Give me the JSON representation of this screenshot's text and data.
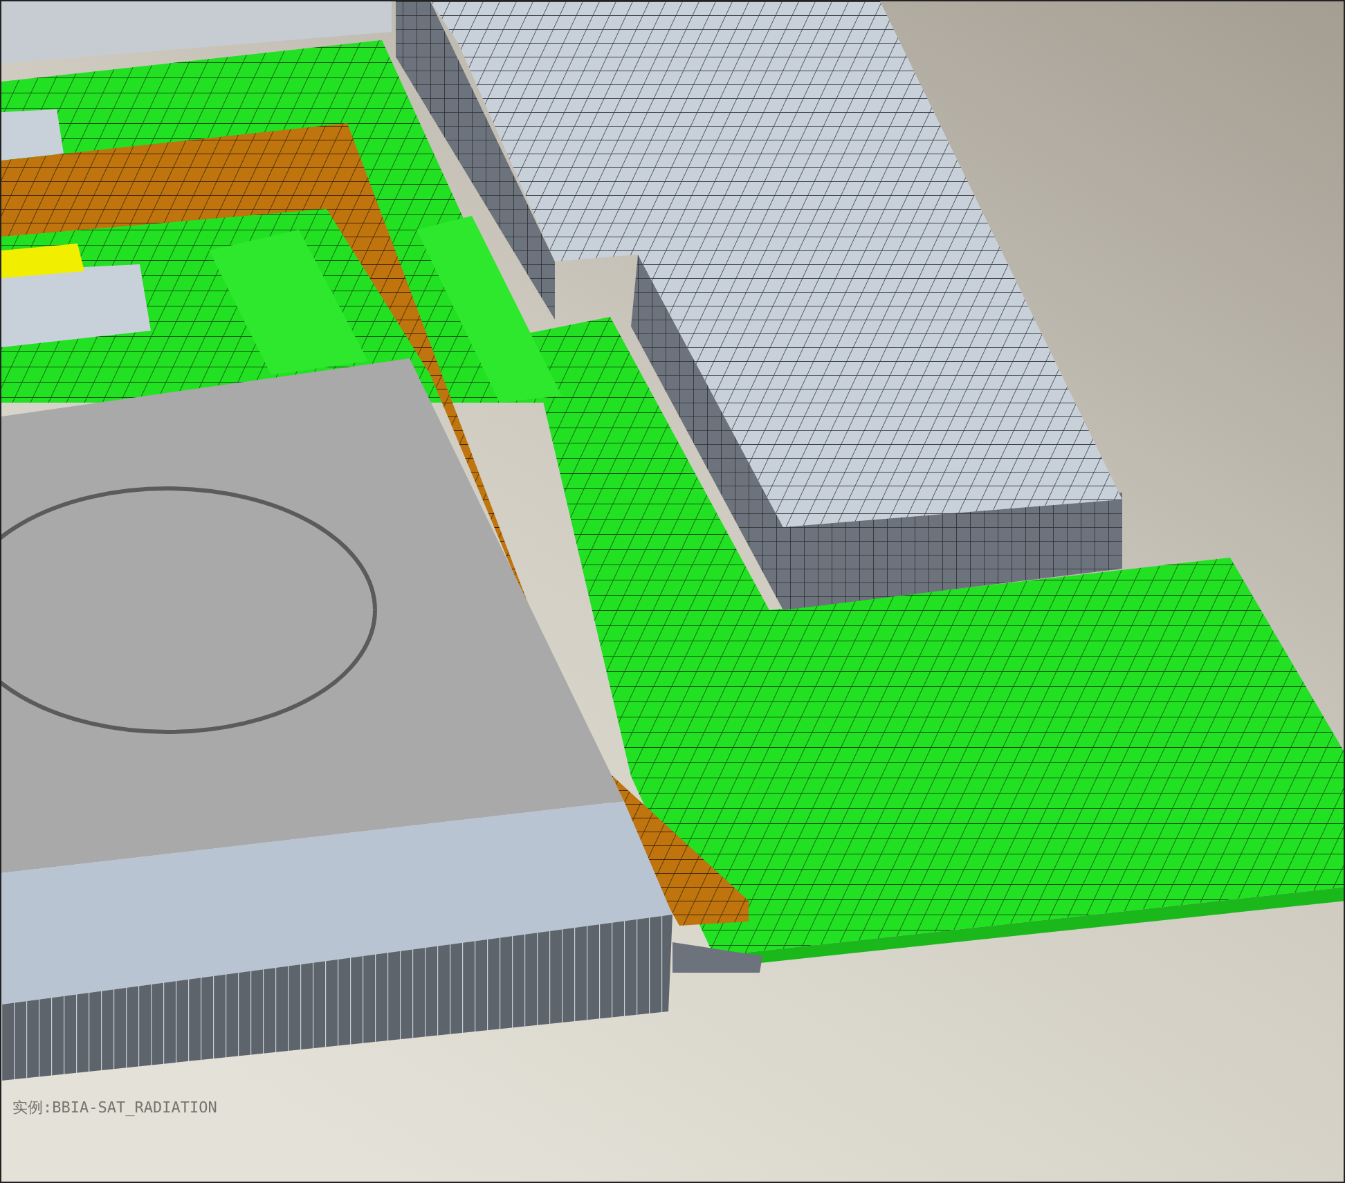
{
  "viewport": {
    "label": "实例:BBIA-SAT_RADIATION"
  }
}
